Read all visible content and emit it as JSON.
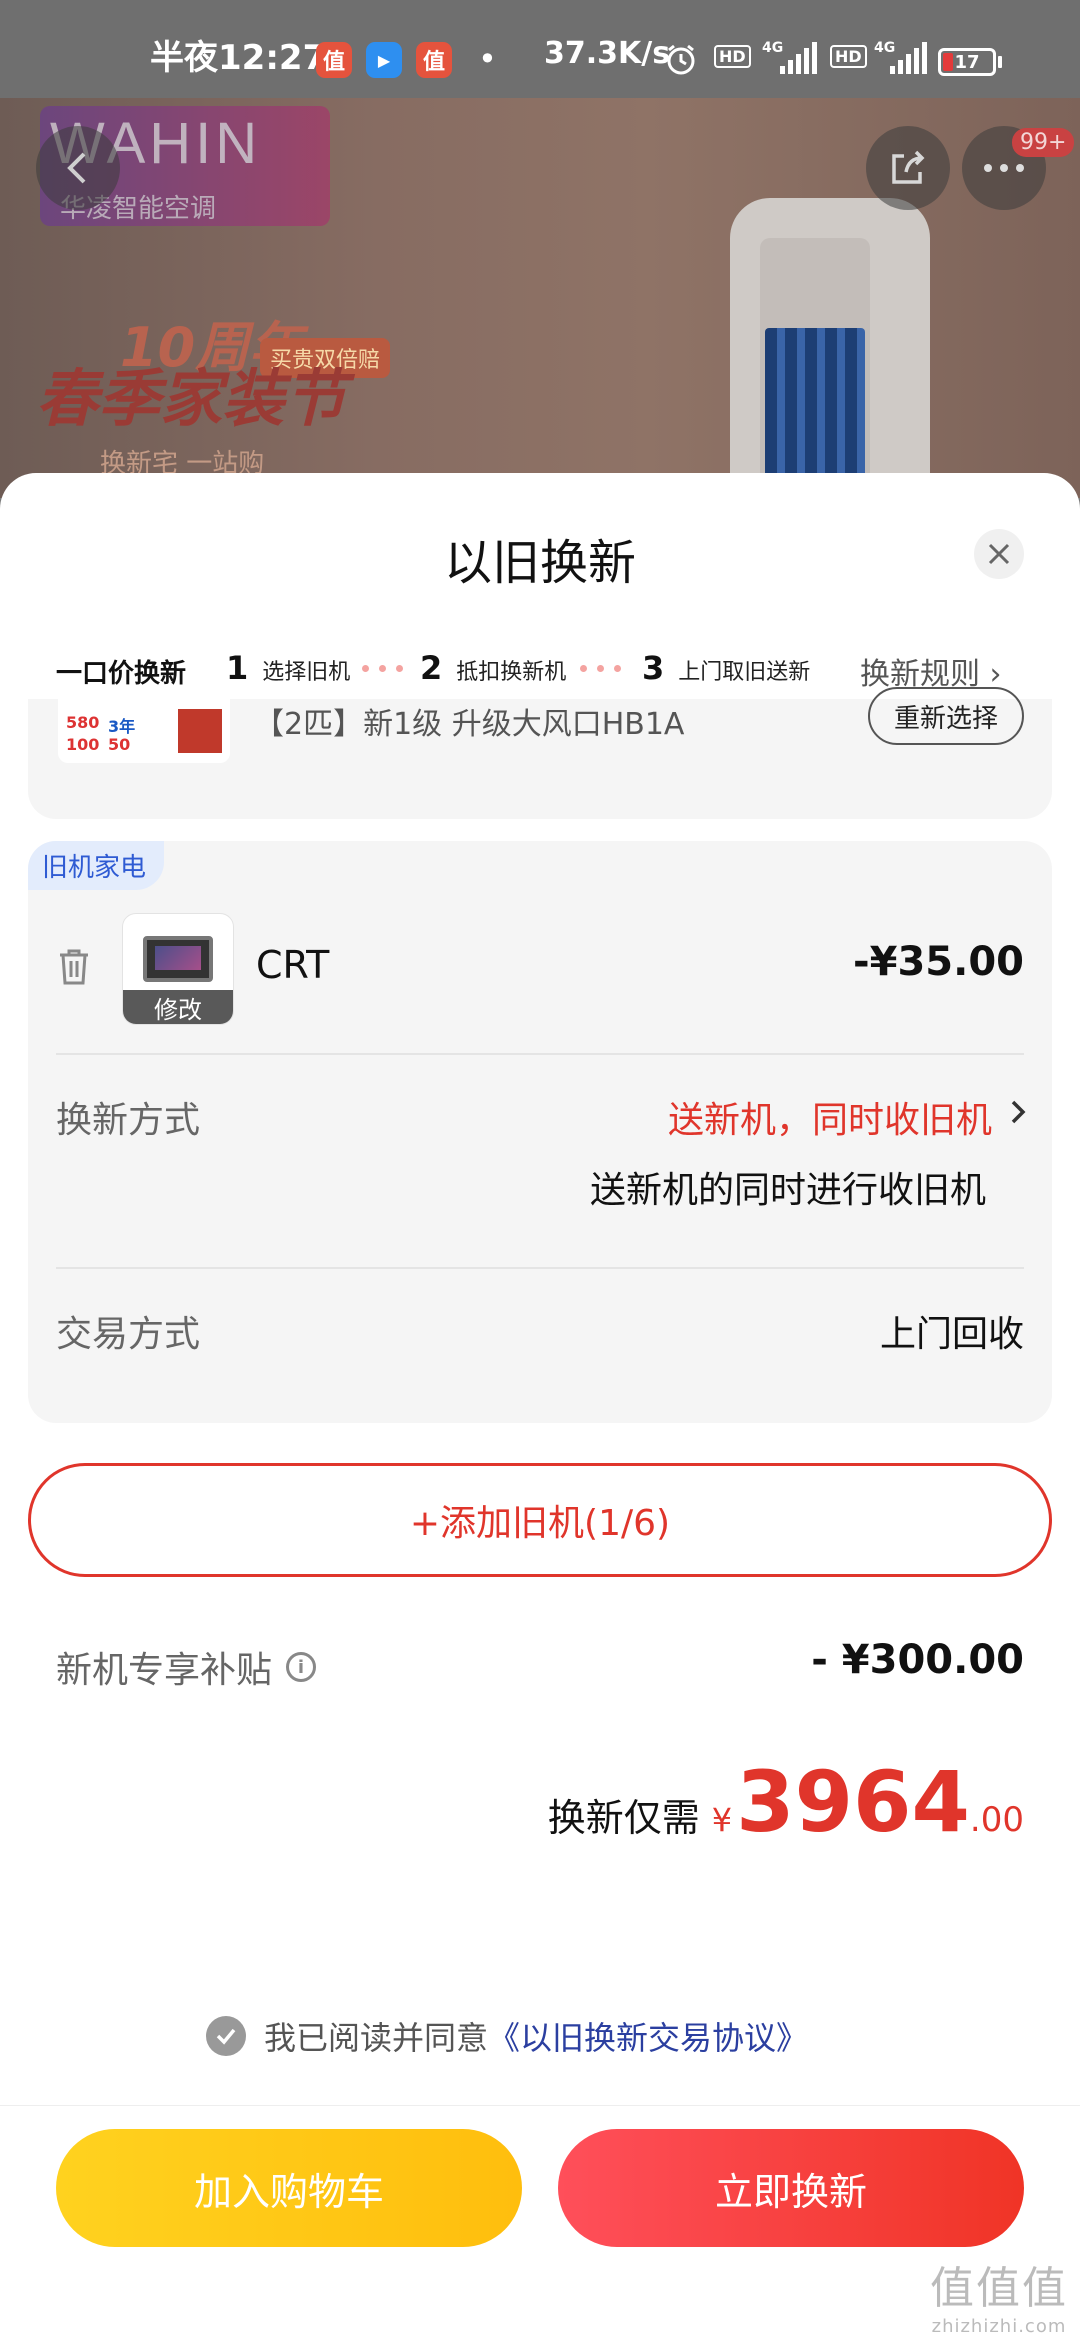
{
  "status_bar": {
    "time": "半夜12:27",
    "app_icon_1": "值",
    "app_icon_2": "▶",
    "app_icon_3": "值",
    "dot": "•",
    "speed": "37.3K/s",
    "hd_1": "HD",
    "net_1": "4G",
    "hd_2": "HD",
    "net_2": "4G",
    "battery": "17"
  },
  "hero": {
    "brand": "WAHIN",
    "brand_sub": "华凌智能空调",
    "promo_anniv": "10周年",
    "promo_title": "春季家装节",
    "promo_tag": "买贵双倍赔",
    "promo_sub": "换新宅 一站购",
    "notif_badge": "99+"
  },
  "sheet": {
    "title": "以旧换新",
    "steps": {
      "first": "一口价换新",
      "items": [
        {
          "num": "1",
          "label": "选择旧机"
        },
        {
          "num": "2",
          "label": "抵扣换新机"
        },
        {
          "num": "3",
          "label": "上门取旧送新"
        }
      ],
      "rules": "换新规则 ›"
    },
    "product": {
      "name": "【2匹】新1级 升级大风口HB1A",
      "reselect": "重新选择",
      "thumb_text": [
        "580",
        "3年",
        "100",
        "50"
      ]
    },
    "old_item": {
      "tag": "旧机家电",
      "name": "CRT",
      "modify": "修改",
      "price": "-¥35.00",
      "method_label": "换新方式",
      "method_value": "送新机，同时收旧机",
      "method_desc": "送新机的同时进行收旧机",
      "trade_label": "交易方式",
      "trade_value": "上门回收"
    },
    "add_old": "+添加旧机(1/6)",
    "subsidy_label": "新机专享补贴",
    "subsidy_value": "- ¥300.00",
    "total_label": "换新仅需",
    "total_currency": "¥",
    "total_int": "3964",
    "total_dec": ".00",
    "agree_text": "我已阅读并同意",
    "agree_link": "《以旧换新交易协议》",
    "btn_cart": "加入购物车",
    "btn_trade": "立即换新"
  },
  "watermark": {
    "line1": "值值值",
    "line2": "zhizhizhi.com"
  },
  "colors": {
    "accent_red": "#e0352b",
    "link_blue": "#2b3fa0",
    "tag_blue": "#2f5bd3",
    "cart_yellow": "#ffc715"
  }
}
